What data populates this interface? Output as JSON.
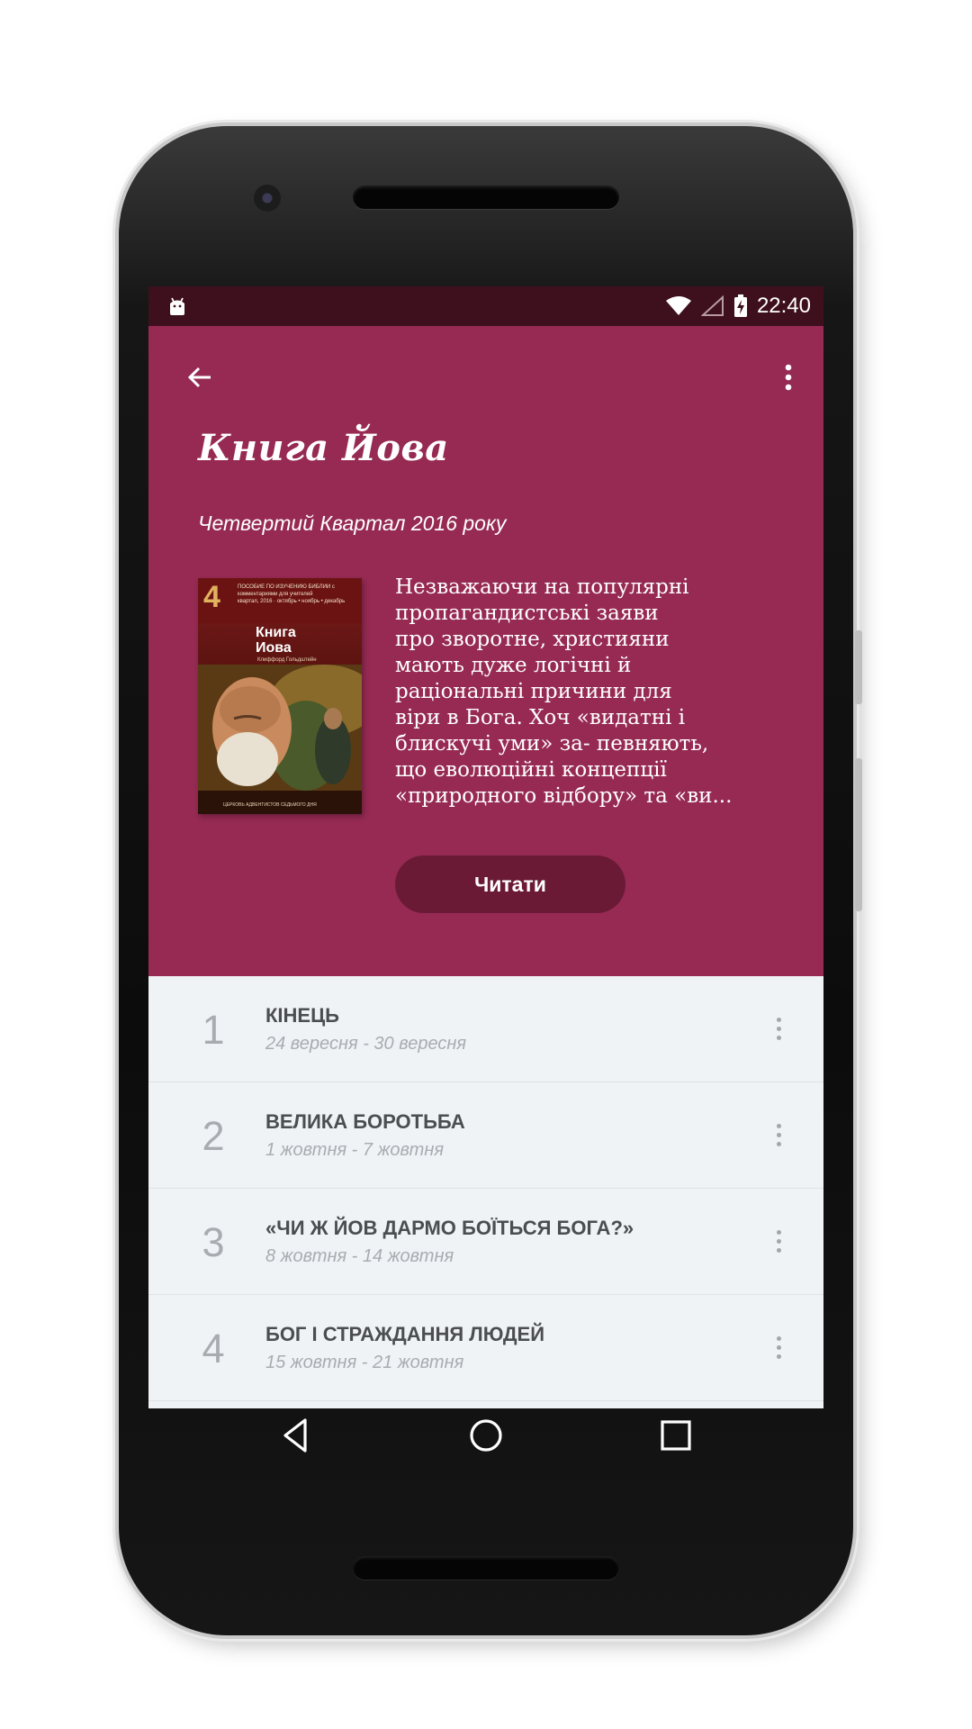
{
  "status_bar": {
    "time": "22:40"
  },
  "toolbar": {
    "back_icon": "arrow-left-icon",
    "more_icon": "more-vert-icon"
  },
  "header": {
    "title": "Книга Йова",
    "subtitle": "Четвертий Квартал 2016 року",
    "description_lines": [
      "Незважаючи на популярні",
      "пропагандистські заяви",
      "про зворотне, християни",
      "мають дуже логічні й",
      "раціональні причини для",
      "віри в Бога. Хоч «видатні і",
      "блискучі уми» за- певняють,",
      "що еволюційні концепції",
      "«природного відбору» та «ви..."
    ],
    "read_button": "Читати",
    "accent_color": "#962a53",
    "button_color": "#6b1a35"
  },
  "cover": {
    "number": "4",
    "top_text": "ПОСОБИЕ ПО ИЗУЧЕНИЮ БИБЛИИ с комментариями для учителей",
    "quarter_text": "квартал, 2016 · октябрь • ноябрь • декабрь",
    "title": "Книга Иова",
    "author": "Клиффорд Гольдштейн",
    "org": "ЦЕРКОВЬ АДВЕНТИСТОВ СЕДЬМОГО ДНЯ"
  },
  "lessons": [
    {
      "number": "1",
      "title": "КІНЕЦЬ",
      "dates": "24 вересня - 30 вересня"
    },
    {
      "number": "2",
      "title": "ВЕЛИКА БОРОТЬБА",
      "dates": "1 жовтня - 7 жовтня"
    },
    {
      "number": "3",
      "title": "«ЧИ Ж ЙОВ ДАРМО БОЇТЬСЯ БОГА?»",
      "dates": "8 жовтня - 14 жовтня"
    },
    {
      "number": "4",
      "title": "БОГ І СТРАЖДАННЯ ЛЮДЕЙ",
      "dates": "15 жовтня - 21 жовтня"
    }
  ],
  "nav_bar": {
    "back": "nav-back-icon",
    "home": "nav-home-icon",
    "recents": "nav-recents-icon"
  }
}
